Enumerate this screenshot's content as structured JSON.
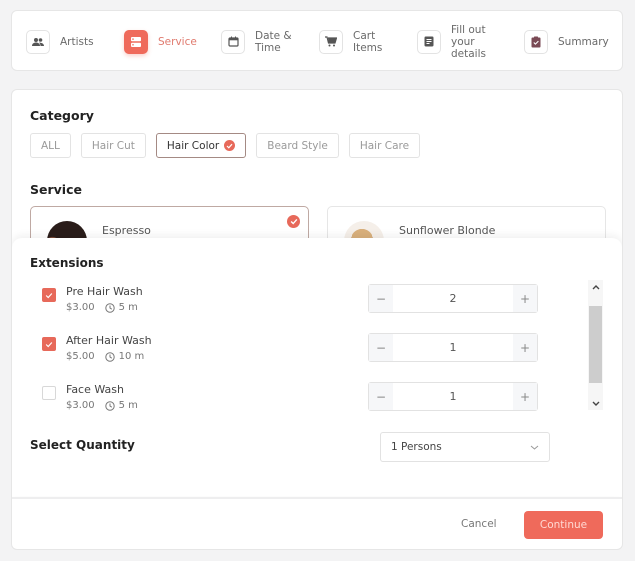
{
  "colors": {
    "accent": "#ef6a5b",
    "selected_border": "#bfa9a3"
  },
  "stepper": [
    {
      "label": "Artists",
      "icon": "people-icon",
      "active": false
    },
    {
      "label": "Service",
      "icon": "service-list-icon",
      "active": true
    },
    {
      "label": "Date & Time",
      "icon": "calendar-icon",
      "active": false
    },
    {
      "label": "Cart Items",
      "icon": "cart-icon",
      "active": false
    },
    {
      "label": "Fill out your details",
      "icon": "form-icon",
      "active": false
    },
    {
      "label": "Summary",
      "icon": "clipboard-check-icon",
      "active": false
    }
  ],
  "category": {
    "title": "Category",
    "chips": [
      {
        "label": "ALL",
        "selected": false
      },
      {
        "label": "Hair Cut",
        "selected": false
      },
      {
        "label": "Hair Color",
        "selected": true
      },
      {
        "label": "Beard Style",
        "selected": false
      },
      {
        "label": "Hair Care",
        "selected": false
      }
    ]
  },
  "service": {
    "title": "Service",
    "cards": [
      {
        "name": "Espresso",
        "selected": true
      },
      {
        "name": "Sunflower Blonde",
        "selected": false
      }
    ]
  },
  "extensions": {
    "title": "Extensions",
    "items": [
      {
        "name": "Pre Hair Wash",
        "price": "$3.00",
        "duration": "5 m",
        "checked": true,
        "quantity": "2"
      },
      {
        "name": "After Hair Wash",
        "price": "$5.00",
        "duration": "10 m",
        "checked": true,
        "quantity": "1"
      },
      {
        "name": "Face Wash",
        "price": "$3.00",
        "duration": "5 m",
        "checked": false,
        "quantity": "1"
      }
    ],
    "minus": "−",
    "plus": "+"
  },
  "select_quantity": {
    "label": "Select Quantity",
    "value": "1 Persons"
  },
  "footer": {
    "cancel": "Cancel",
    "continue": "Continue"
  }
}
